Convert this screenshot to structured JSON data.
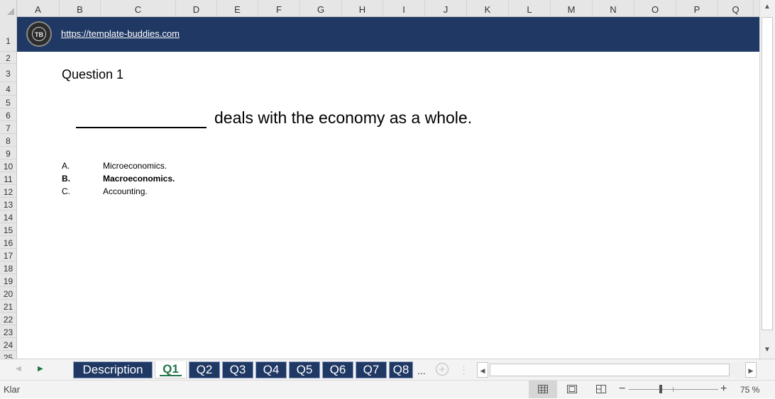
{
  "columns": [
    "A",
    "B",
    "C",
    "D",
    "E",
    "F",
    "G",
    "H",
    "I",
    "J",
    "K",
    "L",
    "M",
    "N",
    "O",
    "P",
    "Q"
  ],
  "rows": [
    "1",
    "2",
    "3",
    "4",
    "5",
    "6",
    "7",
    "8",
    "9",
    "10",
    "11",
    "12",
    "13",
    "14",
    "15",
    "16",
    "17",
    "18",
    "19",
    "20",
    "21",
    "22",
    "23",
    "24",
    "25"
  ],
  "banner": {
    "logo_text": "TB",
    "link_text": "https://template-buddies.com"
  },
  "content": {
    "question_title": "Question 1",
    "question_text": "deals with the economy as a whole.",
    "options": [
      {
        "letter": "A.",
        "text": "Microeconomics."
      },
      {
        "letter": "B.",
        "text": "Macroeconomics."
      },
      {
        "letter": "C.",
        "text": "Accounting."
      }
    ]
  },
  "tabs": [
    "Description",
    "Q1",
    "Q2",
    "Q3",
    "Q4",
    "Q5",
    "Q6",
    "Q7",
    "Q8"
  ],
  "active_tab": "Q1",
  "tab_more": "...",
  "add_sheet_symbol": "+",
  "status": {
    "ready_text": "Klar",
    "zoom_minus": "−",
    "zoom_plus": "+",
    "zoom_level": "75 %",
    "zoom_fraction": 0.75
  },
  "colors": {
    "banner": "#1f3864",
    "tab_bg": "#1f3864",
    "active_tab_text": "#217346"
  },
  "icons": {
    "corner": "select-all-icon",
    "scroll_up": "scroll-up-arrow-icon",
    "scroll_down": "scroll-down-arrow-icon",
    "scroll_left": "scroll-left-arrow-icon",
    "scroll_right": "scroll-right-arrow-icon",
    "normal_view": "grid-view-icon",
    "page_layout": "page-layout-icon",
    "page_break": "page-break-icon"
  }
}
